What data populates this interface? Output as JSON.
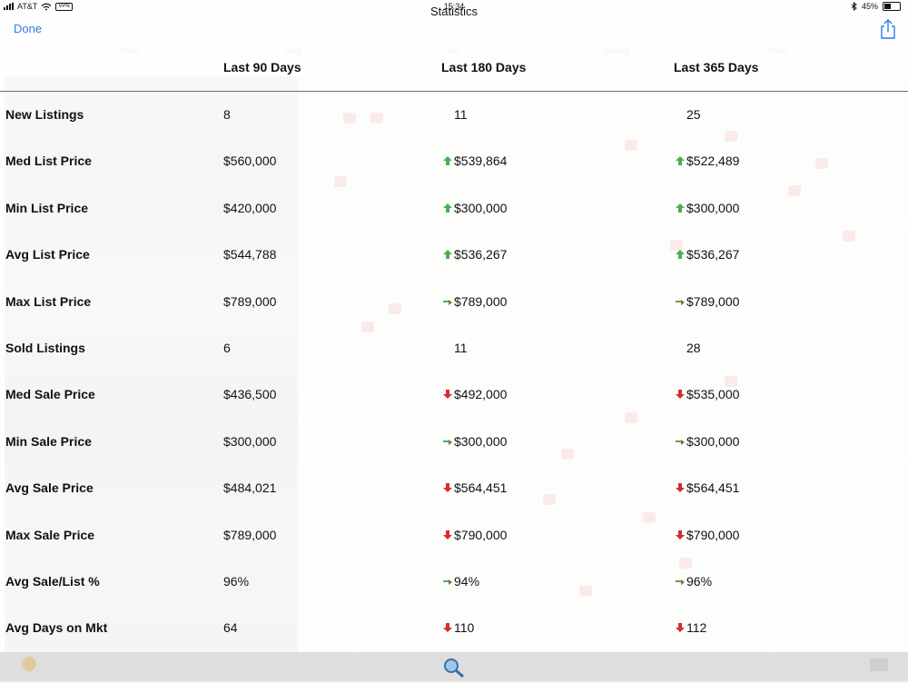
{
  "status_bar": {
    "carrier": "AT&T",
    "vpn": "VPN",
    "time": "15:34",
    "battery": "45%",
    "battery_level": 0.45
  },
  "nav": {
    "title": "Statistics",
    "done_label": "Done"
  },
  "columns": [
    "Last 90 Days",
    "Last 180 Days",
    "Last 365 Days"
  ],
  "rows": [
    {
      "label": "New Listings",
      "v90": "8",
      "v180": "11",
      "t180": "none",
      "v365": "25",
      "t365": "none"
    },
    {
      "label": "Med List Price",
      "v90": "$560,000",
      "v180": "$539,864",
      "t180": "up",
      "v365": "$522,489",
      "t365": "up"
    },
    {
      "label": "Min List Price",
      "v90": "$420,000",
      "v180": "$300,000",
      "t180": "up",
      "v365": "$300,000",
      "t365": "up"
    },
    {
      "label": "Avg List Price",
      "v90": "$544,788",
      "v180": "$536,267",
      "t180": "up",
      "v365": "$536,267",
      "t365": "up"
    },
    {
      "label": "Max List Price",
      "v90": "$789,000",
      "v180": "$789,000",
      "t180": "same",
      "v365": "$789,000",
      "t365": "same"
    },
    {
      "label": "Sold Listings",
      "v90": "6",
      "v180": "11",
      "t180": "none",
      "v365": "28",
      "t365": "none"
    },
    {
      "label": "Med Sale Price",
      "v90": "$436,500",
      "v180": "$492,000",
      "t180": "down",
      "v365": "$535,000",
      "t365": "down"
    },
    {
      "label": "Min Sale Price",
      "v90": "$300,000",
      "v180": "$300,000",
      "t180": "same",
      "v365": "$300,000",
      "t365": "same"
    },
    {
      "label": "Avg Sale Price",
      "v90": "$484,021",
      "v180": "$564,451",
      "t180": "down",
      "v365": "$564,451",
      "t365": "down"
    },
    {
      "label": "Max Sale Price",
      "v90": "$789,000",
      "v180": "$790,000",
      "t180": "down",
      "v365": "$790,000",
      "t365": "down"
    },
    {
      "label": "Avg Sale/List %",
      "v90": "96%",
      "v180": "94%",
      "t180": "same",
      "v365": "96%",
      "t365": "same"
    },
    {
      "label": "Avg Days on Mkt",
      "v90": "64",
      "v180": "110",
      "t180": "down",
      "v365": "112",
      "t365": "down"
    }
  ],
  "colors": {
    "accent": "#2f7ae5",
    "trend_up": "#4caf50",
    "trend_down": "#d32f2f",
    "trend_same": "#8a6d3b"
  },
  "icons": {
    "share": "share-icon",
    "up": "green-arrow-up-icon",
    "down": "red-arrow-down-icon",
    "same": "sideways-arrow-icon"
  },
  "bg_tabs": [
    "stats",
    "map",
    "list",
    "gallery",
    "draw"
  ]
}
